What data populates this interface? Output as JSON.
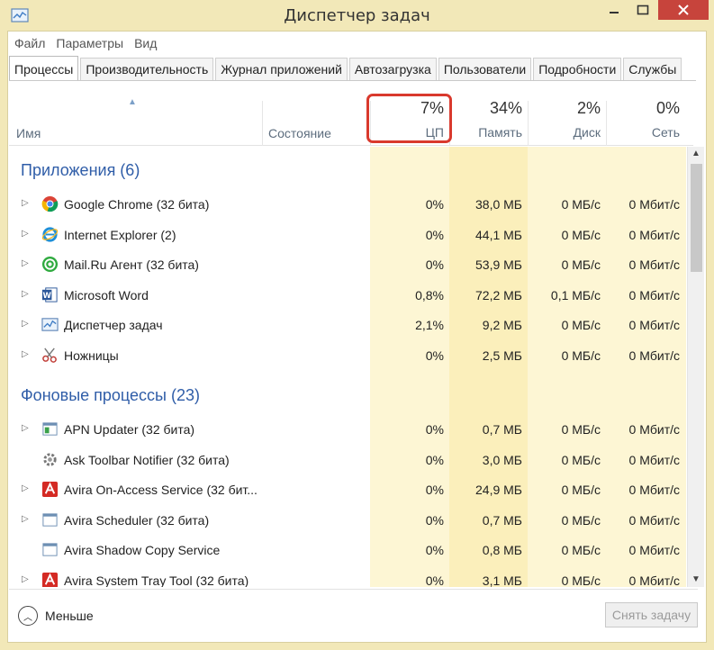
{
  "window": {
    "title": "Диспетчер задач"
  },
  "menu": [
    "Файл",
    "Параметры",
    "Вид"
  ],
  "tabs": [
    "Процессы",
    "Производительность",
    "Журнал приложений",
    "Автозагрузка",
    "Пользователи",
    "Подробности",
    "Службы"
  ],
  "header": {
    "name_label": "Имя",
    "state_label": "Состояние",
    "cpu": {
      "pct": "7%",
      "label": "ЦП"
    },
    "memory": {
      "pct": "34%",
      "label": "Память"
    },
    "disk": {
      "pct": "2%",
      "label": "Диск"
    },
    "network": {
      "pct": "0%",
      "label": "Сеть"
    }
  },
  "groups": {
    "apps": "Приложения (6)",
    "background": "Фоновые процессы (23)"
  },
  "apps": [
    {
      "name": "Google Chrome (32 бита)",
      "icon": "chrome-icon",
      "cpu": "0%",
      "mem": "38,0 МБ",
      "disk": "0 МБ/с",
      "net": "0 Мбит/с"
    },
    {
      "name": "Internet Explorer (2)",
      "icon": "internet-explorer-icon",
      "cpu": "0%",
      "mem": "44,1 МБ",
      "disk": "0 МБ/с",
      "net": "0 Мбит/с"
    },
    {
      "name": "Mail.Ru Агент (32 бита)",
      "icon": "mailru-agent-icon",
      "cpu": "0%",
      "mem": "53,9 МБ",
      "disk": "0 МБ/с",
      "net": "0 Мбит/с"
    },
    {
      "name": "Microsoft Word",
      "icon": "word-icon",
      "cpu": "0,8%",
      "mem": "72,2 МБ",
      "disk": "0,1 МБ/с",
      "net": "0 Мбит/с"
    },
    {
      "name": "Диспетчер задач",
      "icon": "task-manager-icon",
      "cpu": "2,1%",
      "mem": "9,2 МБ",
      "disk": "0 МБ/с",
      "net": "0 Мбит/с"
    },
    {
      "name": "Ножницы",
      "icon": "scissors-icon",
      "cpu": "0%",
      "mem": "2,5 МБ",
      "disk": "0 МБ/с",
      "net": "0 Мбит/с"
    }
  ],
  "background": [
    {
      "name": "APN Updater (32 бита)",
      "icon": "apn-updater-icon",
      "cpu": "0%",
      "mem": "0,7 МБ",
      "disk": "0 МБ/с",
      "net": "0 Мбит/с"
    },
    {
      "name": "Ask Toolbar Notifier (32 бита)",
      "icon": "gear-icon",
      "cpu": "0%",
      "mem": "3,0 МБ",
      "disk": "0 МБ/с",
      "net": "0 Мбит/с"
    },
    {
      "name": "Avira On-Access Service (32 бит...",
      "icon": "avira-icon",
      "cpu": "0%",
      "mem": "24,9 МБ",
      "disk": "0 МБ/с",
      "net": "0 Мбит/с"
    },
    {
      "name": "Avira Scheduler (32 бита)",
      "icon": "app-window-icon",
      "cpu": "0%",
      "mem": "0,7 МБ",
      "disk": "0 МБ/с",
      "net": "0 Мбит/с"
    },
    {
      "name": "Avira Shadow Copy Service",
      "icon": "app-window-icon",
      "cpu": "0%",
      "mem": "0,8 МБ",
      "disk": "0 МБ/с",
      "net": "0 Мбит/с"
    },
    {
      "name": "Avira System Tray Tool (32 бита)",
      "icon": "avira-icon",
      "cpu": "0%",
      "mem": "3,1 МБ",
      "disk": "0 МБ/с",
      "net": "0 Мбит/с"
    }
  ],
  "footer": {
    "less_label": "Меньше",
    "end_task_label": "Снять задачу"
  },
  "colors": {
    "title_bar": "#f2e8b8",
    "group_text": "#2f5da8",
    "highlight_border": "#d9392d",
    "heat_light": "#fdf8dc",
    "heat_mid": "#fbf0bb",
    "heat_strong": "#f8e7a0"
  }
}
